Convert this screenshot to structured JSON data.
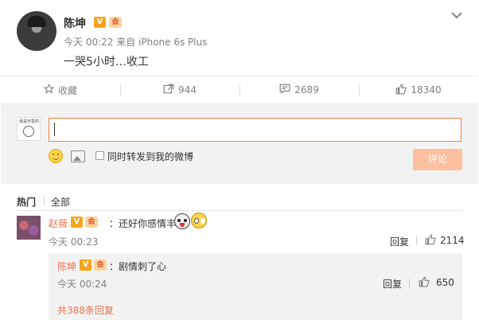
{
  "post": {
    "author": "陈坤",
    "v_badge": "V",
    "vip_badge": "会",
    "meta": "今天 00:22 来自 iPhone 6s Plus",
    "text": "一哭5小时…收工"
  },
  "actions": {
    "favorite": "收藏",
    "repost_count": "944",
    "comment_count": "2689",
    "like_count": "18340"
  },
  "compose": {
    "avatar_text": "我是可爱的",
    "repost_option": "同时转发到我的微博",
    "submit": "评论"
  },
  "sort_tabs": {
    "hot": "热门",
    "all": "全部"
  },
  "comment": {
    "author": "赵薇",
    "text": "：还好你感情丰富",
    "time": "今天 00:23",
    "reply": "回复",
    "likes": "2114"
  },
  "sub_reply": {
    "author": "陈坤",
    "text": "：剧情刺了心",
    "time": "今天 00:24",
    "reply": "回复",
    "likes": "650"
  },
  "more_replies": "共388条回复",
  "colors": {
    "accent": "#eb7350",
    "submit_disabled": "#ffc09f",
    "panel": "#f2f2f2"
  }
}
